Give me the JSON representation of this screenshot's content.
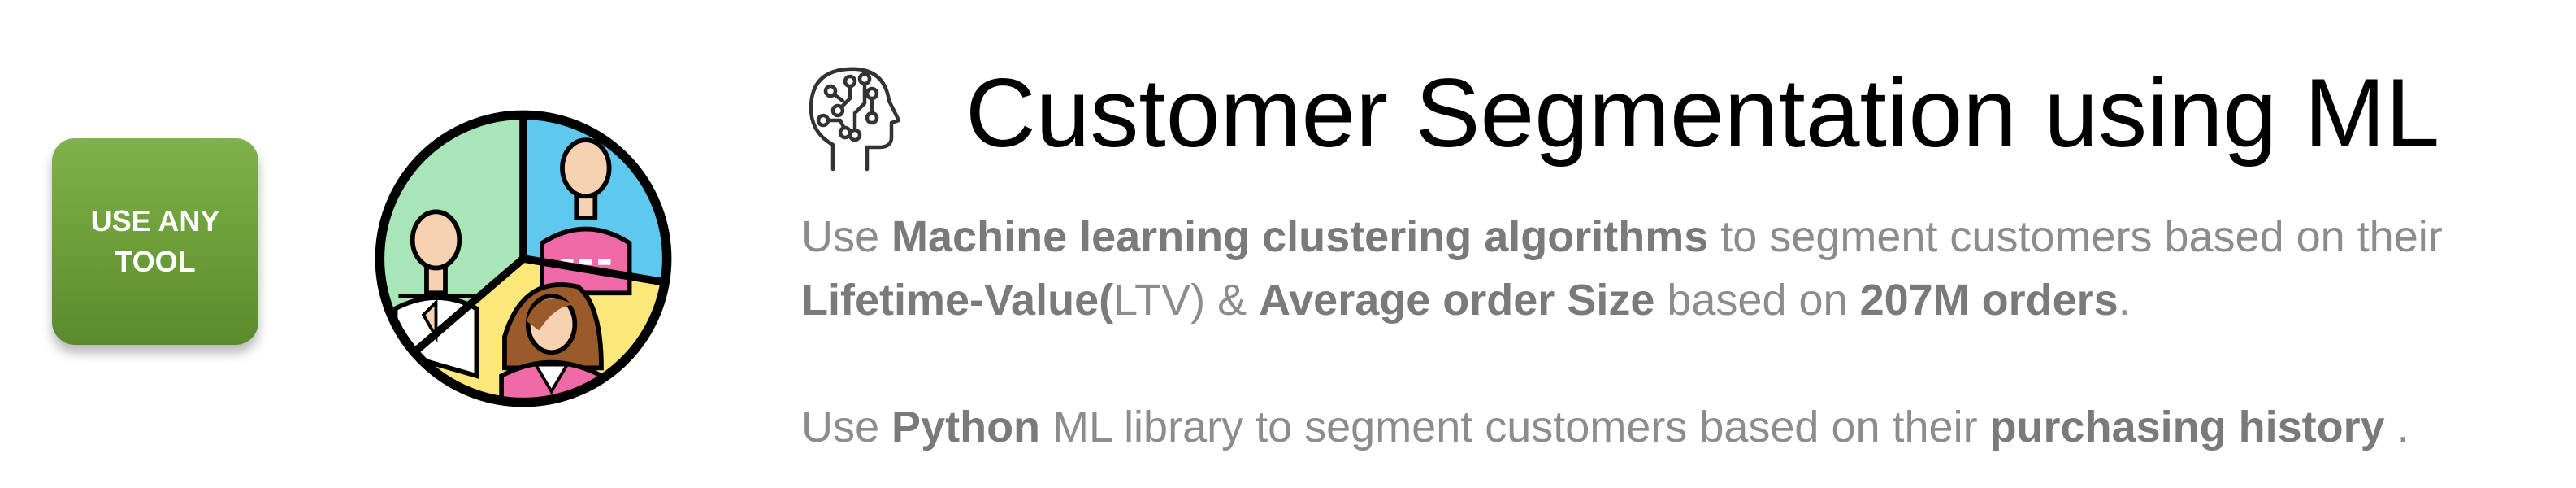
{
  "badge": {
    "label": "USE ANY TOOL",
    "color": "#6fa23c"
  },
  "illustration": {
    "icon": "customer-segments-icon",
    "segment_colors": [
      "#a8e6b8",
      "#5ec8ee",
      "#fbe77a"
    ],
    "accent_colors": {
      "skin": "#f6d2b2",
      "shirt_pink": "#f06aa8",
      "hair": "#9a5a2a"
    }
  },
  "header": {
    "icon": "ai-brain-icon",
    "title": "Customer Segmentation using ML"
  },
  "description": {
    "paragraph1": {
      "t1": "Use ",
      "b1": "Machine learning clustering algorithms",
      "t2": " to segment customers based on their",
      "b2": "Lifetime-Value(",
      "t3": "LTV) & ",
      "b3": "Average order Size",
      "t4": " based on ",
      "b4": "207M orders",
      "t5": "."
    },
    "paragraph2": {
      "t1": "Use ",
      "b1": "Python",
      "t2": " ML library to segment customers based on their ",
      "b2": "purchasing history",
      "t3": " ."
    }
  },
  "colors": {
    "title": "#000000",
    "body_text": "#8c8c8c"
  }
}
